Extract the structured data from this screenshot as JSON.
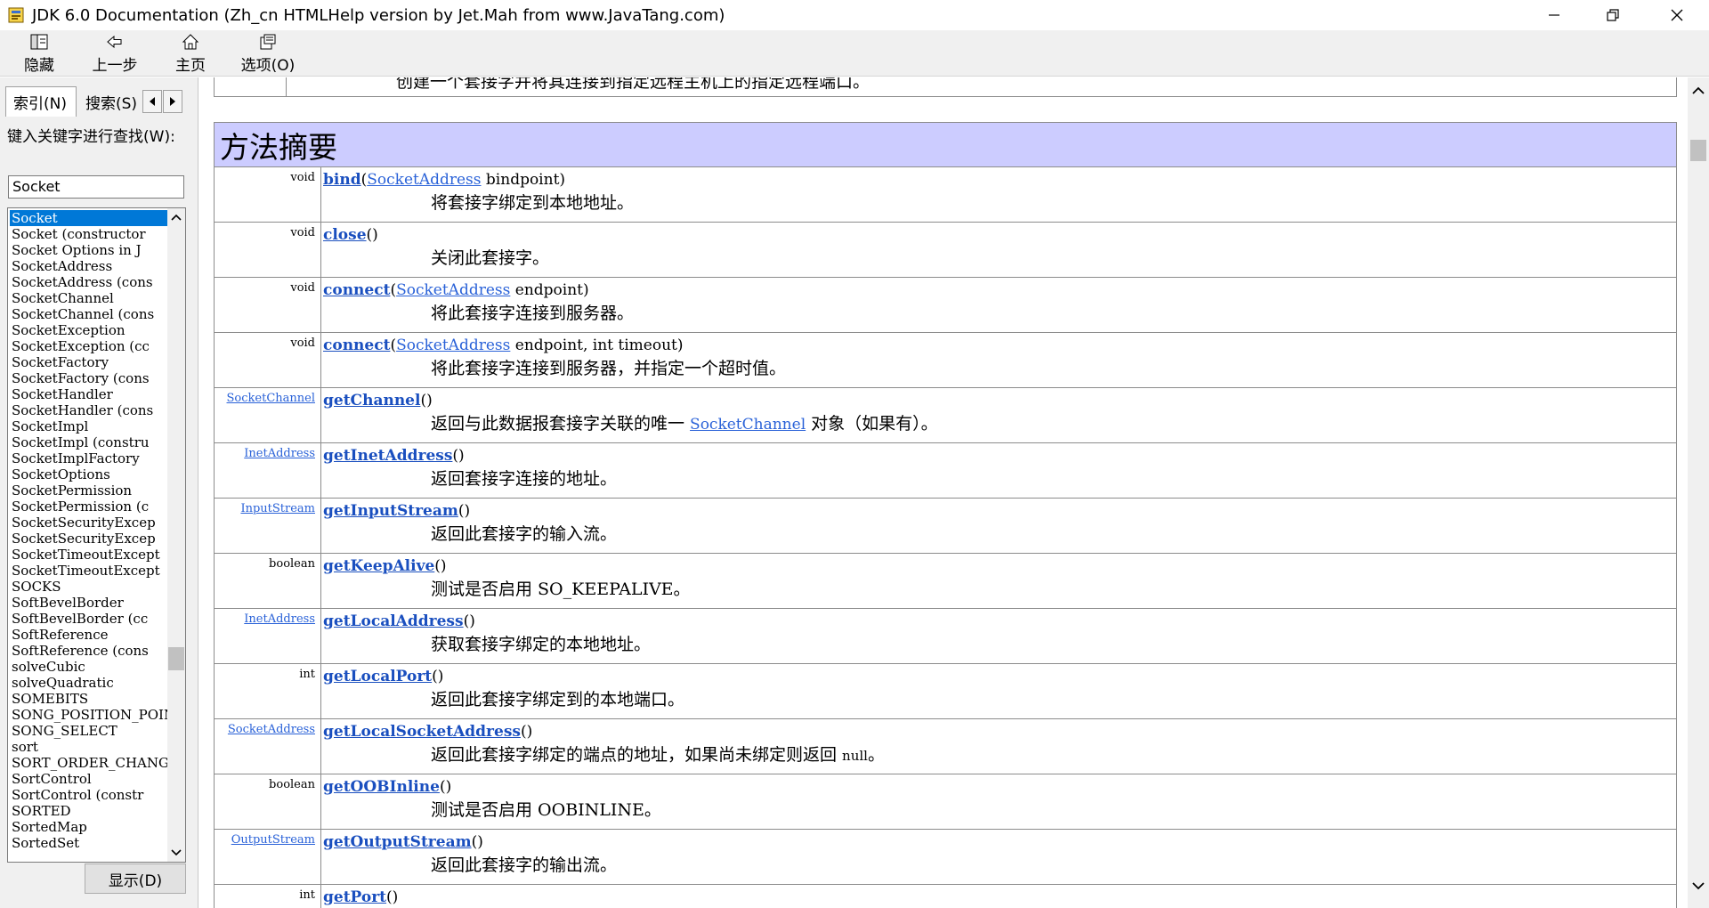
{
  "window": {
    "title": "JDK 6.0 Documentation (Zh_cn HTMLHelp version by Jet.Mah from www.JavaTang.com)"
  },
  "toolbar": {
    "hide_label": "隐藏",
    "back_label": "上一步",
    "home_label": "主页",
    "options_label": "选项(O)"
  },
  "left": {
    "tab_index": "索引(N)",
    "tab_search": "搜索(S)",
    "prompt": "键入关键字进行查找(W):",
    "keyword_value": "Socket",
    "items": [
      "Socket",
      "Socket (constructor",
      "Socket Options in J",
      "SocketAddress",
      "SocketAddress (cons",
      "SocketChannel",
      "SocketChannel (cons",
      "SocketException",
      "SocketException (cc",
      "SocketFactory",
      "SocketFactory (cons",
      "SocketHandler",
      "SocketHandler (cons",
      "SocketImpl",
      "SocketImpl (constru",
      "SocketImplFactory",
      "SocketOptions",
      "SocketPermission",
      "SocketPermission (c",
      "SocketSecurityExcep",
      "SocketSecurityExcep",
      "SocketTimeoutExcept",
      "SocketTimeoutExcept",
      "SOCKS",
      "SoftBevelBorder",
      "SoftBevelBorder (cc",
      "SoftReference",
      "SoftReference (cons",
      "solveCubic",
      "solveQuadratic",
      "SOMEBITS",
      "SONG_POSITION_POINT",
      "SONG_SELECT",
      "sort",
      "SORT_ORDER_CHANGED",
      "SortControl",
      "SortControl (constr",
      "SORTED",
      "SortedMap",
      "SortedSet"
    ],
    "display_button": "显示(D)"
  },
  "content": {
    "prev_row_text": "创建一个套接字并将其连接到指定远程主机上的指定远程端口。",
    "summary_title": "方法摘要",
    "rows": [
      {
        "type": "void",
        "method": "bind",
        "params_pre": "(",
        "ptype": "SocketAddress",
        "params_post": " bindpoint)",
        "desc": "将套接字绑定到本地地址。"
      },
      {
        "type": "void",
        "method": "close",
        "params_pre": "()",
        "desc": "关闭此套接字。"
      },
      {
        "type": "void",
        "method": "connect",
        "params_pre": "(",
        "ptype": "SocketAddress",
        "params_post": " endpoint)",
        "desc": "将此套接字连接到服务器。"
      },
      {
        "type": "void",
        "method": "connect",
        "params_pre": "(",
        "ptype": "SocketAddress",
        "params_post": " endpoint, int timeout)",
        "desc": "将此套接字连接到服务器，并指定一个超时值。"
      },
      {
        "type": "SocketChannel",
        "type_link": true,
        "method": "getChannel",
        "params_pre": "()",
        "desc": "返回与此数据报套接字关联的唯一 ",
        "desc_code": "SocketChannel",
        "desc_post": " 对象（如果有）。"
      },
      {
        "type": "InetAddress",
        "type_link": true,
        "method": "getInetAddress",
        "params_pre": "()",
        "desc": "返回套接字连接的地址。"
      },
      {
        "type": "InputStream",
        "type_link": true,
        "method": "getInputStream",
        "params_pre": "()",
        "desc": "返回此套接字的输入流。"
      },
      {
        "type": "boolean",
        "method": "getKeepAlive",
        "params_pre": "()",
        "desc": "测试是否启用 SO_KEEPALIVE。"
      },
      {
        "type": "InetAddress",
        "type_link": true,
        "method": "getLocalAddress",
        "params_pre": "()",
        "desc": "获取套接字绑定的本地地址。"
      },
      {
        "type": "int",
        "method": "getLocalPort",
        "params_pre": "()",
        "desc": "返回此套接字绑定到的本地端口。"
      },
      {
        "type": "SocketAddress",
        "type_link": true,
        "method": "getLocalSocketAddress",
        "params_pre": "()",
        "desc": "返回此套接字绑定的端点的地址，如果尚未绑定则返回 ",
        "desc_small": "null",
        "desc_post": "。"
      },
      {
        "type": "boolean",
        "method": "getOOBInline",
        "params_pre": "()",
        "desc": "测试是否启用 OOBINLINE。"
      },
      {
        "type": "OutputStream",
        "type_link": true,
        "method": "getOutputStream",
        "params_pre": "()",
        "desc": "返回此套接字的输出流。"
      },
      {
        "type": "int",
        "method": "getPort",
        "params_pre": "()",
        "desc": ""
      }
    ]
  }
}
